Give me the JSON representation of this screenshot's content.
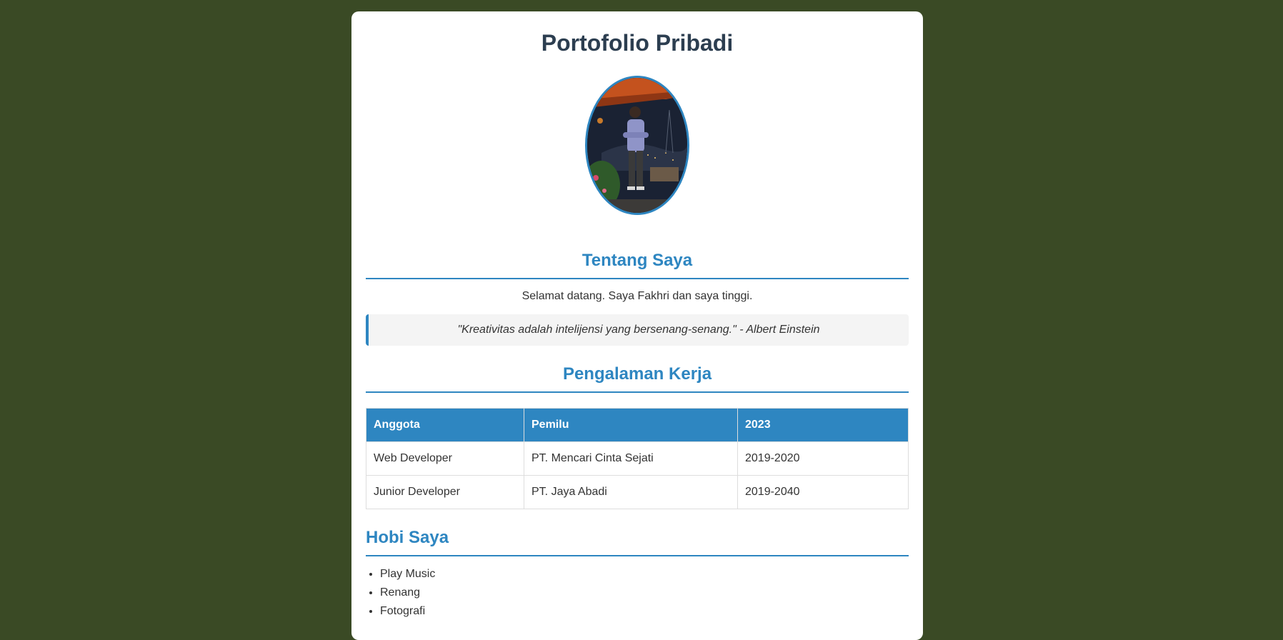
{
  "page": {
    "title": "Portofolio Pribadi"
  },
  "avatar": {
    "alt": "Foto profil"
  },
  "about": {
    "heading": "Tentang Saya",
    "text": "Selamat datang. Saya Fakhri dan saya tinggi.",
    "quote": "\"Kreativitas adalah intelijensi yang bersenang-senang.\" - Albert Einstein"
  },
  "experience": {
    "heading": "Pengalaman Kerja",
    "columns": [
      "Anggota",
      "Pemilu",
      "2023"
    ],
    "rows": [
      [
        "Web Developer",
        "PT. Mencari Cinta Sejati",
        "2019-2020"
      ],
      [
        "Junior Developer",
        "PT. Jaya Abadi",
        "2019-2040"
      ]
    ]
  },
  "hobbies": {
    "heading": "Hobi Saya",
    "items": [
      "Play Music",
      "Renang",
      "Fotografi"
    ]
  },
  "colors": {
    "background": "#3a4a25",
    "accent": "#2e86c1",
    "title": "#2c3e50"
  }
}
